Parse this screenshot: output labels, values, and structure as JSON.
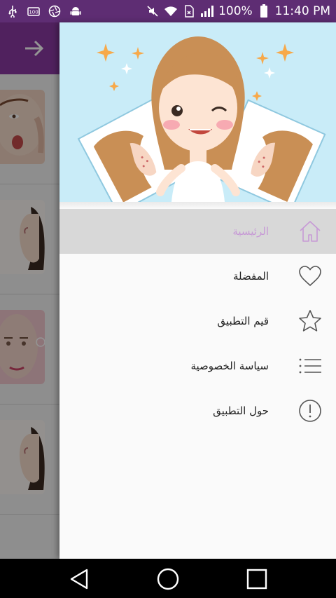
{
  "status_bar": {
    "left_icons": [
      "usb-icon",
      "battery-100-icon",
      "aperture-icon",
      "android-icon"
    ],
    "right_icons": [
      "mute-icon",
      "wifi-icon",
      "no-sim-icon",
      "signal-icon"
    ],
    "battery": "100%",
    "time": "11:40 PM"
  },
  "drawer": {
    "menu": [
      {
        "label": "الرئيسية",
        "icon": "home-icon",
        "active": true
      },
      {
        "label": "المفضلة",
        "icon": "heart-icon",
        "active": false
      },
      {
        "label": "قيم التطبيق",
        "icon": "star-icon",
        "active": false
      },
      {
        "label": "سياسة الخصوصية",
        "icon": "list-icon",
        "active": false
      },
      {
        "label": "حول التطبيق",
        "icon": "info-icon",
        "active": false
      }
    ]
  },
  "colors": {
    "status_bar": "#5e2d73",
    "toolbar": "#8a3aa3",
    "active_item_bg": "#d8d8d8",
    "active_item_text": "#c79ad6",
    "header_bg": "#c9ecf8"
  },
  "navigation": {
    "buttons": [
      "back-icon",
      "home-circle-icon",
      "recents-icon"
    ]
  }
}
